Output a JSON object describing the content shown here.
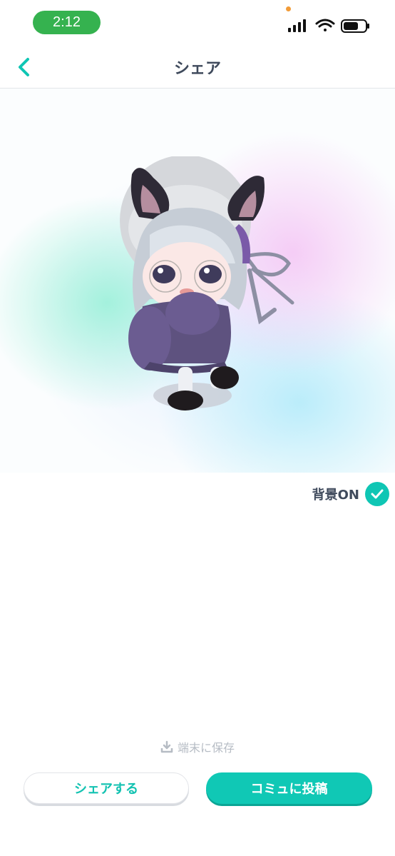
{
  "status_bar": {
    "time": "2:12",
    "icons": [
      "signal-icon",
      "wifi-icon",
      "battery-icon"
    ],
    "time_pill_color": "#35b24f"
  },
  "header": {
    "title": "シェア",
    "back_icon": "chevron-left-icon",
    "accent_color": "#0fc6b4"
  },
  "preview": {
    "avatar": "chibi-avatar-image"
  },
  "background_toggle": {
    "label": "背景ON",
    "checked": true
  },
  "save": {
    "label": "端末に保存",
    "icon": "download-icon"
  },
  "buttons": {
    "share_label": "シェアする",
    "post_label": "コミュに投稿"
  }
}
